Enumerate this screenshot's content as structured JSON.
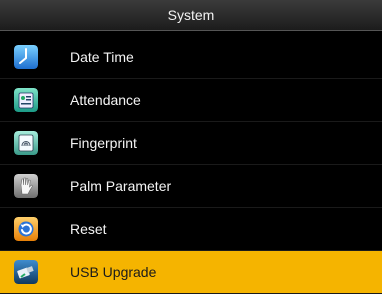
{
  "header": {
    "title": "System"
  },
  "menu": {
    "items": [
      {
        "label": "Date Time",
        "icon": "clock-icon",
        "selected": false
      },
      {
        "label": "Attendance",
        "icon": "attendance-icon",
        "selected": false
      },
      {
        "label": "Fingerprint",
        "icon": "fingerprint-icon",
        "selected": false
      },
      {
        "label": "Palm Parameter",
        "icon": "palm-icon",
        "selected": false
      },
      {
        "label": "Reset",
        "icon": "reset-icon",
        "selected": false
      },
      {
        "label": "USB Upgrade",
        "icon": "usb-icon",
        "selected": true
      }
    ],
    "selected_color": "#f5b400"
  }
}
